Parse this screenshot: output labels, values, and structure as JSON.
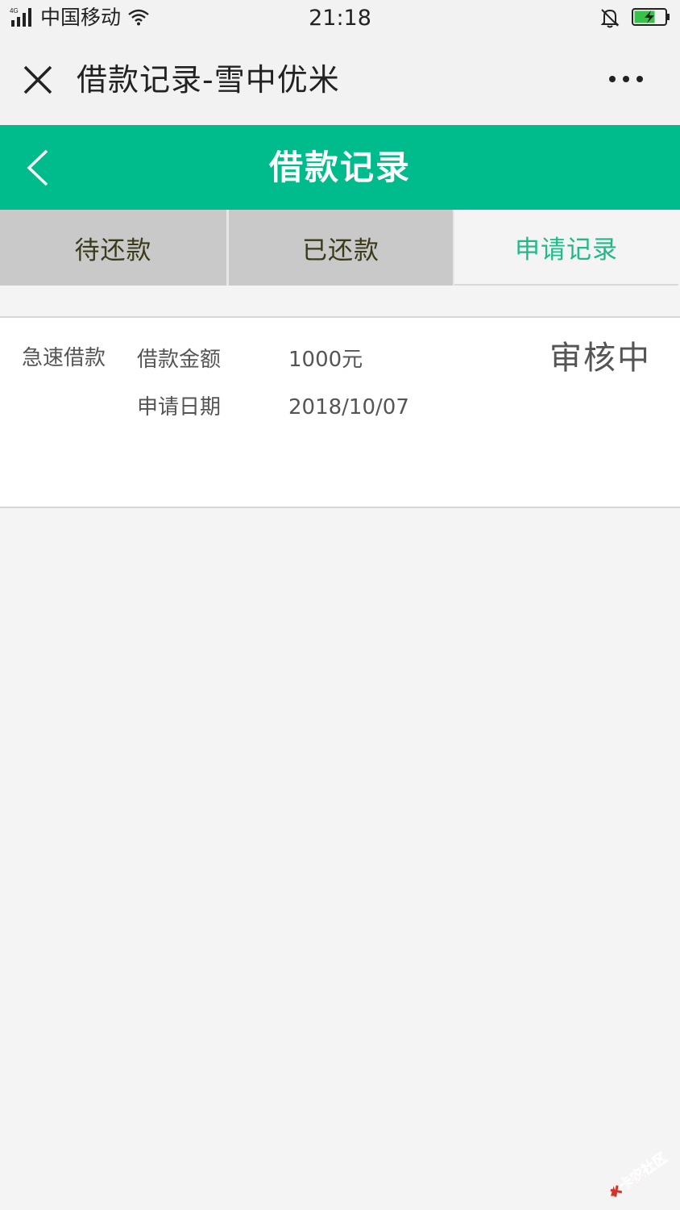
{
  "status_bar": {
    "network": "4G",
    "carrier": "中国移动",
    "time": "21:18"
  },
  "title_bar": {
    "title": "借款记录-雪中优米"
  },
  "header": {
    "title": "借款记录"
  },
  "tabs": [
    {
      "label": "待还款",
      "active": false
    },
    {
      "label": "已还款",
      "active": false
    },
    {
      "label": "申请记录",
      "active": true
    }
  ],
  "record": {
    "type": "急速借款",
    "amount_label": "借款金额",
    "amount_value": "1000元",
    "date_label": "申请日期",
    "date_value": "2018/10/07",
    "status": "审核中"
  },
  "watermark": {
    "text": "卡农社区"
  },
  "colors": {
    "brand_green": "#00bb8b",
    "active_tab_text": "#1fb98a",
    "inactive_tab_bg": "#c9c9c9"
  },
  "icons": [
    "signal-icon",
    "wifi-icon",
    "bell-muted-icon",
    "battery-charging-icon",
    "close-icon",
    "more-icon",
    "back-chevron-icon"
  ]
}
